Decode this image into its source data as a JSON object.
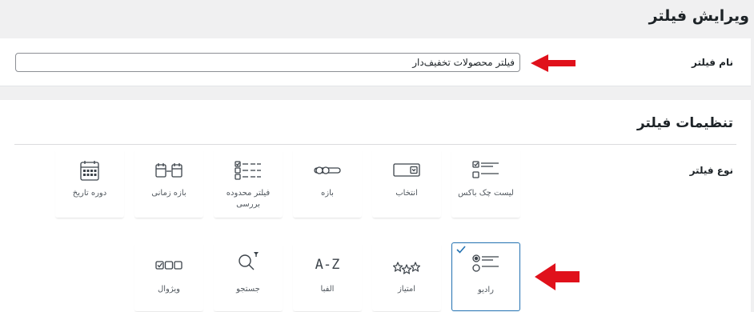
{
  "page": {
    "title": "ویرایش فیلتر"
  },
  "name_field": {
    "label": "نام فیلتر",
    "value": "فیلتر محصولات تخفیف‌دار"
  },
  "settings": {
    "title": "تنظیمات فیلتر",
    "type_label": "نوع فیلتر",
    "selected": "radio",
    "types": [
      {
        "id": "checklist",
        "label": "لیست چک باکس",
        "icon": "checklist-icon"
      },
      {
        "id": "select",
        "label": "انتخاب",
        "icon": "dropdown-select-icon"
      },
      {
        "id": "range",
        "label": "بازه",
        "icon": "range-slider-icon"
      },
      {
        "id": "limited-check",
        "label": "فیلتر محدوده بررسی",
        "icon": "limited-checklist-icon"
      },
      {
        "id": "time-range",
        "label": "بازه زمانی",
        "icon": "time-range-icon"
      },
      {
        "id": "date-period",
        "label": "دوره تاریخ",
        "icon": "calendar-icon"
      },
      {
        "id": "radio",
        "label": "رادیو",
        "icon": "radio-list-icon"
      },
      {
        "id": "rating",
        "label": "امتیاز",
        "icon": "stars-icon"
      },
      {
        "id": "alphabet",
        "label": "الفبا",
        "icon": "a-z-icon"
      },
      {
        "id": "search",
        "label": "جستجو",
        "icon": "search-filter-icon"
      },
      {
        "id": "visual",
        "label": "ویژوال",
        "icon": "visual-swatches-icon"
      }
    ]
  },
  "colors": {
    "accent": "#2271b1",
    "annotation_arrow": "#e0111b",
    "page_bg": "#f0f0f1"
  },
  "alphabet_icon_text": "A-Z"
}
